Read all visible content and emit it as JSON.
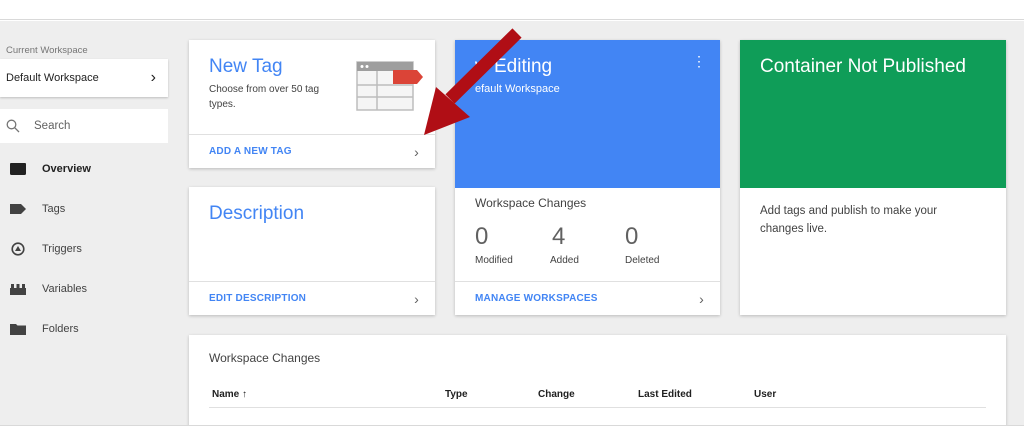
{
  "sidebar": {
    "workspace_label": "Current Workspace",
    "workspace_name": "Default Workspace",
    "search_placeholder": "Search",
    "nav": [
      {
        "label": "Overview",
        "icon": "overview-icon",
        "active": true
      },
      {
        "label": "Tags",
        "icon": "tag-icon"
      },
      {
        "label": "Triggers",
        "icon": "trigger-icon"
      },
      {
        "label": "Variables",
        "icon": "variables-icon"
      },
      {
        "label": "Folders",
        "icon": "folder-icon"
      }
    ]
  },
  "new_tag": {
    "title": "New Tag",
    "description": "Choose from over 50 tag types.",
    "link": "ADD A NEW TAG"
  },
  "description_card": {
    "title": "Description",
    "link": "EDIT DESCRIPTION"
  },
  "editing": {
    "title": "w Editing",
    "subtitle": "efault Workspace",
    "changes_title": "Workspace Changes",
    "stats": [
      {
        "value": "0",
        "label": "Modified"
      },
      {
        "value": "4",
        "label": "Added"
      },
      {
        "value": "0",
        "label": "Deleted"
      }
    ],
    "link": "MANAGE WORKSPACES"
  },
  "publish": {
    "title": "Container Not Published",
    "message": "Add tags and publish to make your changes live."
  },
  "changes_table": {
    "title": "Workspace Changes",
    "columns": [
      "Name ↑",
      "Type",
      "Change",
      "Last Edited",
      "User"
    ]
  },
  "colors": {
    "accent_blue": "#4285f4",
    "publish_green": "#0f9d58",
    "arrow_red": "#b00e15"
  }
}
